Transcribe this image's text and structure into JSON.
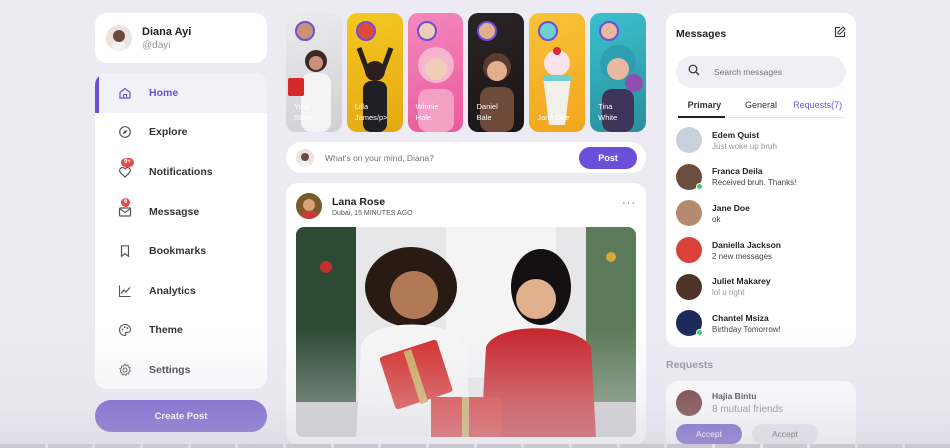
{
  "profile": {
    "name": "Diana Ayi",
    "handle": "@dayi"
  },
  "nav": {
    "items": [
      {
        "label": "Home",
        "icon": "home-icon",
        "active": true
      },
      {
        "label": "Explore",
        "icon": "compass-icon"
      },
      {
        "label": "Notifications",
        "icon": "heart-icon",
        "badge": "9+"
      },
      {
        "label": "Messagse",
        "icon": "mail-icon",
        "badge": "6"
      },
      {
        "label": "Bookmarks",
        "icon": "bookmark-icon"
      },
      {
        "label": "Analytics",
        "icon": "chart-icon"
      },
      {
        "label": "Theme",
        "icon": "palette-icon"
      },
      {
        "label": "Settings",
        "icon": "gear-icon"
      }
    ],
    "create_label": "Create Post"
  },
  "stories": [
    {
      "line1": "Your",
      "line2": "Story",
      "bg": "#d8d8dc"
    },
    {
      "line1": "Lilla",
      "line2": "James/p>",
      "bg": "#f0c020"
    },
    {
      "line1": "Winnie",
      "line2": "Hale",
      "bg": "#f06aa8"
    },
    {
      "line1": "Daniel",
      "line2": "Bale",
      "bg": "#2a2426"
    },
    {
      "line1": "Jane Doe",
      "line2": "",
      "bg": "#f5b52a"
    },
    {
      "line1": "Tina",
      "line2": "White",
      "bg": "#3ab9c9"
    }
  ],
  "compose": {
    "placeholder": "What's on your mind, Diana?",
    "post_label": "Post"
  },
  "feed": {
    "name": "Lana Rose",
    "meta": "Dubai, 15 MINUTES AGO",
    "menu": "···"
  },
  "messages": {
    "title": "Messages",
    "search_placeholder": "Search messages",
    "tabs": [
      "Primary",
      "General",
      "Requests(7)"
    ],
    "list": [
      {
        "name": "Edem Quist",
        "text": "Just woke up bruh",
        "muted": true,
        "online": false,
        "color": "#c7d2dc"
      },
      {
        "name": "Franca Deila",
        "text": "Received bruh. Thanks!",
        "muted": false,
        "online": true,
        "color": "#6b4e3d"
      },
      {
        "name": "Jane Doe",
        "text": "ok",
        "muted": false,
        "online": false,
        "color": "#b58a70"
      },
      {
        "name": "Daniella Jackson",
        "text": "2 new messages",
        "muted": false,
        "online": false,
        "color": "#d9423a"
      },
      {
        "name": "Juliet Makarey",
        "text": "lol u right",
        "muted": true,
        "online": false,
        "color": "#4e3428"
      },
      {
        "name": "Chantel Msiza",
        "text": "Birthday Tomorrow!",
        "muted": false,
        "online": true,
        "color": "#1c2a5c"
      }
    ]
  },
  "requests": {
    "title": "Requests",
    "name": "Hajia Bintu",
    "sub": "8 mutual friends",
    "accept1": "Accept",
    "accept2": "Accept"
  },
  "colors": {
    "accent": "#6b4fd8",
    "button": "#5b3fc4",
    "online": "#3cd070",
    "badge": "#e64a4a"
  }
}
